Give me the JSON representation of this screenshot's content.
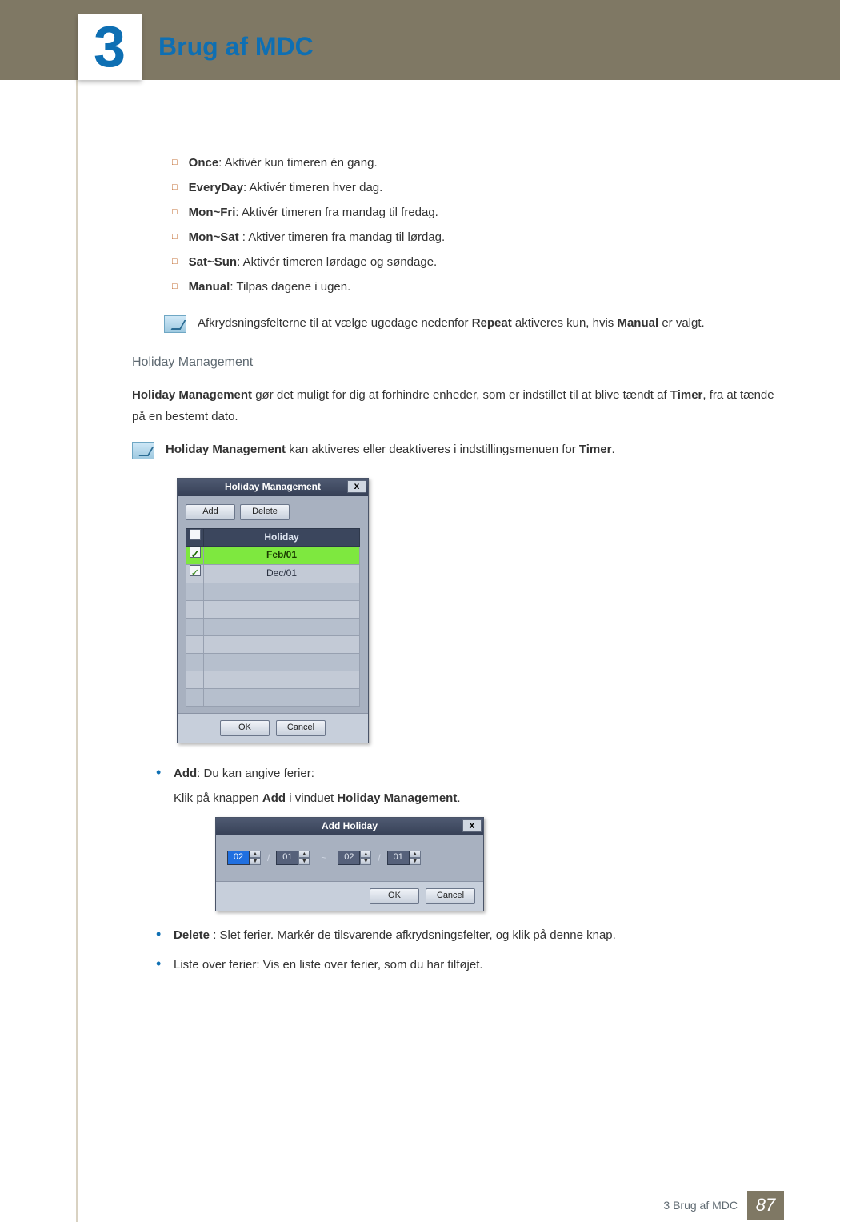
{
  "header": {
    "chapter_number": "3",
    "chapter_title": "Brug af MDC"
  },
  "options": [
    {
      "term": "Once",
      "desc": ": Aktivér kun timeren én gang."
    },
    {
      "term": "EveryDay",
      "desc": ": Aktivér timeren hver dag."
    },
    {
      "term": "Mon~Fri",
      "desc": ": Aktivér timeren fra mandag til fredag."
    },
    {
      "term": "Mon~Sat",
      "desc": " : Aktiver timeren fra mandag til lørdag."
    },
    {
      "term": "Sat~Sun",
      "desc": ": Aktivér timeren lørdage og søndage."
    },
    {
      "term": "Manual",
      "desc": ": Tilpas dagene i ugen."
    }
  ],
  "note1": {
    "pre": "Afkrydsningsfelterne til at vælge ugedage nedenfor ",
    "b1": "Repeat",
    "mid": " aktiveres kun, hvis ",
    "b2": "Manual",
    "post": " er valgt."
  },
  "holiday": {
    "subhead": "Holiday Management",
    "para_b1": "Holiday Management",
    "para_mid": " gør det muligt for dig at forhindre enheder, som er indstillet til at blive tændt af ",
    "para_b2": "Timer",
    "para_post": ", fra at tænde på en bestemt dato."
  },
  "note2": {
    "b1": "Holiday Management",
    "mid": " kan aktiveres eller deaktiveres i indstillingsmenuen for ",
    "b2": "Timer",
    "post": "."
  },
  "hm_dialog": {
    "title": "Holiday Management",
    "close": "x",
    "add": "Add",
    "delete": "Delete",
    "col_holiday": "Holiday",
    "rows": [
      {
        "checked": true,
        "label": "Feb/01",
        "selected": true
      },
      {
        "checked": true,
        "label": "Dec/01",
        "selected": false
      }
    ],
    "ok": "OK",
    "cancel": "Cancel"
  },
  "bullets": {
    "add_b": "Add",
    "add_desc": ": Du kan angive ferier:",
    "add_line2_pre": "Klik på knappen ",
    "add_line2_b1": "Add",
    "add_line2_mid": " i vinduet ",
    "add_line2_b2": "Holiday Management",
    "add_line2_post": ".",
    "delete_b": "Delete",
    "delete_desc": " : Slet ferier. Markér de tilsvarende afkrydsningsfelter, og klik på denne knap.",
    "list_desc": "Liste over ferier: Vis en liste over ferier, som du har tilføjet."
  },
  "ah_dialog": {
    "title": "Add Holiday",
    "close": "x",
    "m1": "02",
    "d1": "01",
    "tilde": "~",
    "m2": "02",
    "d2": "01",
    "ok": "OK",
    "cancel": "Cancel"
  },
  "footer": {
    "text": "3 Brug af MDC",
    "page": "87"
  }
}
